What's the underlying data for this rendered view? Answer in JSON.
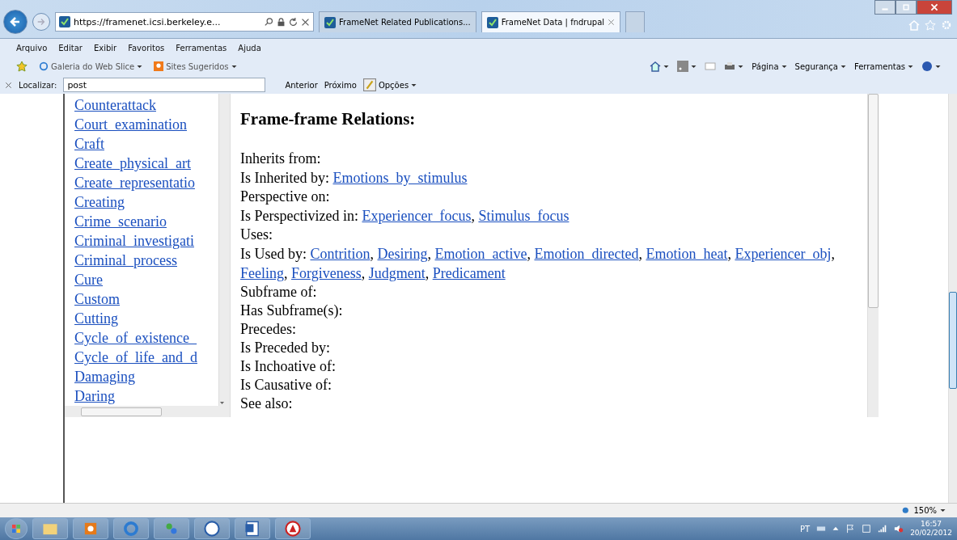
{
  "browser": {
    "address": "https://framenet.icsi.berkeley.e...",
    "tabs": [
      {
        "label": "FrameNet Related Publications...",
        "selected": false
      },
      {
        "label": "FrameNet Data | fndrupal",
        "selected": true
      }
    ]
  },
  "menu": [
    "Arquivo",
    "Editar",
    "Exibir",
    "Favoritos",
    "Ferramentas",
    "Ajuda"
  ],
  "favorites": [
    "Galeria do Web Slice",
    "Sites Sugeridos"
  ],
  "command_bar": [
    "Página",
    "Segurança",
    "Ferramentas"
  ],
  "find_bar": {
    "label": "Localizar:",
    "value": "post",
    "buttons": [
      "Anterior",
      "Próximo"
    ],
    "options": "Opções"
  },
  "frame_list": [
    "Counterattack",
    "Court_examination",
    "Craft",
    "Create_physical_art",
    "Create_representatio",
    "Creating",
    "Crime_scenario",
    "Criminal_investigati",
    "Criminal_process",
    "Cure",
    "Custom",
    "Cutting",
    "Cycle_of_existence_",
    "Cycle_of_life_and_d",
    "Damaging",
    "Daring"
  ],
  "relations": {
    "title": "Frame-frame Relations:",
    "rows": [
      {
        "label": "Inherits from:"
      },
      {
        "label": "Is Inherited by:",
        "links": [
          {
            "text": "Emotions_by_stimulus"
          }
        ]
      },
      {
        "label": "Perspective on:"
      },
      {
        "label": "Is Perspectivized in:",
        "links": [
          {
            "text": "Experiencer_focus",
            "after": ","
          },
          {
            "text": "Stimulus_focus"
          }
        ]
      },
      {
        "label": "Uses:"
      },
      {
        "label": "Is Used by:",
        "links": [
          {
            "text": "Contrition",
            "after": ","
          },
          {
            "text": "Desiring",
            "after": ","
          },
          {
            "text": "Emotion_active",
            "after": ","
          },
          {
            "text": "Emotion_directed",
            "after": ","
          },
          {
            "text": "Emotion_heat",
            "after": ","
          },
          {
            "text": "Experiencer_obj",
            "after": ","
          },
          {
            "text": "Feeling",
            "after": ","
          },
          {
            "text": "Forgiveness",
            "after": ","
          },
          {
            "text": "Judgment",
            "after": ","
          },
          {
            "text": "Predicament"
          }
        ]
      },
      {
        "label": "Subframe of:"
      },
      {
        "label": "Has Subframe(s):"
      },
      {
        "label": "Precedes:"
      },
      {
        "label": "Is Preceded by:"
      },
      {
        "label": "Is Inchoative of:"
      },
      {
        "label": "Is Causative of:"
      },
      {
        "label": "See also:"
      }
    ]
  },
  "status_bar": {
    "zoom": "150%"
  },
  "taskbar": {
    "language": "PT",
    "time": "16:57",
    "date": "20/02/2012"
  }
}
